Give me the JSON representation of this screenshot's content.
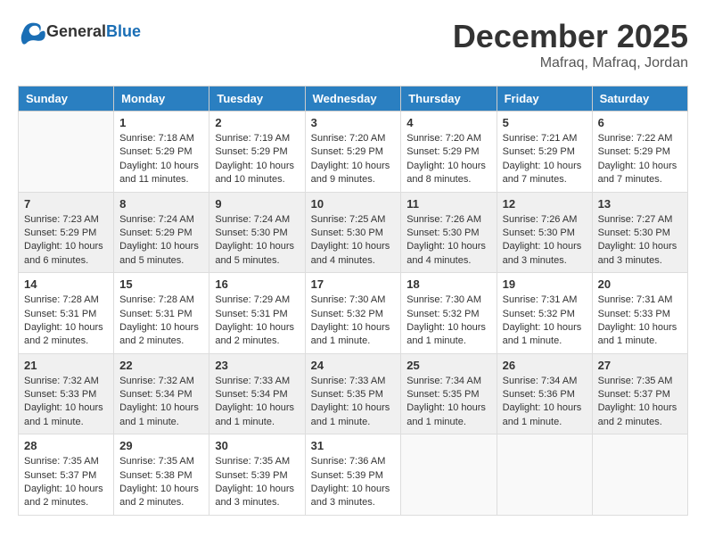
{
  "header": {
    "logo_general": "General",
    "logo_blue": "Blue",
    "month": "December 2025",
    "location": "Mafraq, Mafraq, Jordan"
  },
  "weekdays": [
    "Sunday",
    "Monday",
    "Tuesday",
    "Wednesday",
    "Thursday",
    "Friday",
    "Saturday"
  ],
  "weeks": [
    [
      {
        "day": "",
        "info": ""
      },
      {
        "day": "1",
        "info": "Sunrise: 7:18 AM\nSunset: 5:29 PM\nDaylight: 10 hours\nand 11 minutes."
      },
      {
        "day": "2",
        "info": "Sunrise: 7:19 AM\nSunset: 5:29 PM\nDaylight: 10 hours\nand 10 minutes."
      },
      {
        "day": "3",
        "info": "Sunrise: 7:20 AM\nSunset: 5:29 PM\nDaylight: 10 hours\nand 9 minutes."
      },
      {
        "day": "4",
        "info": "Sunrise: 7:20 AM\nSunset: 5:29 PM\nDaylight: 10 hours\nand 8 minutes."
      },
      {
        "day": "5",
        "info": "Sunrise: 7:21 AM\nSunset: 5:29 PM\nDaylight: 10 hours\nand 7 minutes."
      },
      {
        "day": "6",
        "info": "Sunrise: 7:22 AM\nSunset: 5:29 PM\nDaylight: 10 hours\nand 7 minutes."
      }
    ],
    [
      {
        "day": "7",
        "info": "Sunrise: 7:23 AM\nSunset: 5:29 PM\nDaylight: 10 hours\nand 6 minutes."
      },
      {
        "day": "8",
        "info": "Sunrise: 7:24 AM\nSunset: 5:29 PM\nDaylight: 10 hours\nand 5 minutes."
      },
      {
        "day": "9",
        "info": "Sunrise: 7:24 AM\nSunset: 5:30 PM\nDaylight: 10 hours\nand 5 minutes."
      },
      {
        "day": "10",
        "info": "Sunrise: 7:25 AM\nSunset: 5:30 PM\nDaylight: 10 hours\nand 4 minutes."
      },
      {
        "day": "11",
        "info": "Sunrise: 7:26 AM\nSunset: 5:30 PM\nDaylight: 10 hours\nand 4 minutes."
      },
      {
        "day": "12",
        "info": "Sunrise: 7:26 AM\nSunset: 5:30 PM\nDaylight: 10 hours\nand 3 minutes."
      },
      {
        "day": "13",
        "info": "Sunrise: 7:27 AM\nSunset: 5:30 PM\nDaylight: 10 hours\nand 3 minutes."
      }
    ],
    [
      {
        "day": "14",
        "info": "Sunrise: 7:28 AM\nSunset: 5:31 PM\nDaylight: 10 hours\nand 2 minutes."
      },
      {
        "day": "15",
        "info": "Sunrise: 7:28 AM\nSunset: 5:31 PM\nDaylight: 10 hours\nand 2 minutes."
      },
      {
        "day": "16",
        "info": "Sunrise: 7:29 AM\nSunset: 5:31 PM\nDaylight: 10 hours\nand 2 minutes."
      },
      {
        "day": "17",
        "info": "Sunrise: 7:30 AM\nSunset: 5:32 PM\nDaylight: 10 hours\nand 1 minute."
      },
      {
        "day": "18",
        "info": "Sunrise: 7:30 AM\nSunset: 5:32 PM\nDaylight: 10 hours\nand 1 minute."
      },
      {
        "day": "19",
        "info": "Sunrise: 7:31 AM\nSunset: 5:32 PM\nDaylight: 10 hours\nand 1 minute."
      },
      {
        "day": "20",
        "info": "Sunrise: 7:31 AM\nSunset: 5:33 PM\nDaylight: 10 hours\nand 1 minute."
      }
    ],
    [
      {
        "day": "21",
        "info": "Sunrise: 7:32 AM\nSunset: 5:33 PM\nDaylight: 10 hours\nand 1 minute."
      },
      {
        "day": "22",
        "info": "Sunrise: 7:32 AM\nSunset: 5:34 PM\nDaylight: 10 hours\nand 1 minute."
      },
      {
        "day": "23",
        "info": "Sunrise: 7:33 AM\nSunset: 5:34 PM\nDaylight: 10 hours\nand 1 minute."
      },
      {
        "day": "24",
        "info": "Sunrise: 7:33 AM\nSunset: 5:35 PM\nDaylight: 10 hours\nand 1 minute."
      },
      {
        "day": "25",
        "info": "Sunrise: 7:34 AM\nSunset: 5:35 PM\nDaylight: 10 hours\nand 1 minute."
      },
      {
        "day": "26",
        "info": "Sunrise: 7:34 AM\nSunset: 5:36 PM\nDaylight: 10 hours\nand 1 minute."
      },
      {
        "day": "27",
        "info": "Sunrise: 7:35 AM\nSunset: 5:37 PM\nDaylight: 10 hours\nand 2 minutes."
      }
    ],
    [
      {
        "day": "28",
        "info": "Sunrise: 7:35 AM\nSunset: 5:37 PM\nDaylight: 10 hours\nand 2 minutes."
      },
      {
        "day": "29",
        "info": "Sunrise: 7:35 AM\nSunset: 5:38 PM\nDaylight: 10 hours\nand 2 minutes."
      },
      {
        "day": "30",
        "info": "Sunrise: 7:35 AM\nSunset: 5:39 PM\nDaylight: 10 hours\nand 3 minutes."
      },
      {
        "day": "31",
        "info": "Sunrise: 7:36 AM\nSunset: 5:39 PM\nDaylight: 10 hours\nand 3 minutes."
      },
      {
        "day": "",
        "info": ""
      },
      {
        "day": "",
        "info": ""
      },
      {
        "day": "",
        "info": ""
      }
    ]
  ]
}
